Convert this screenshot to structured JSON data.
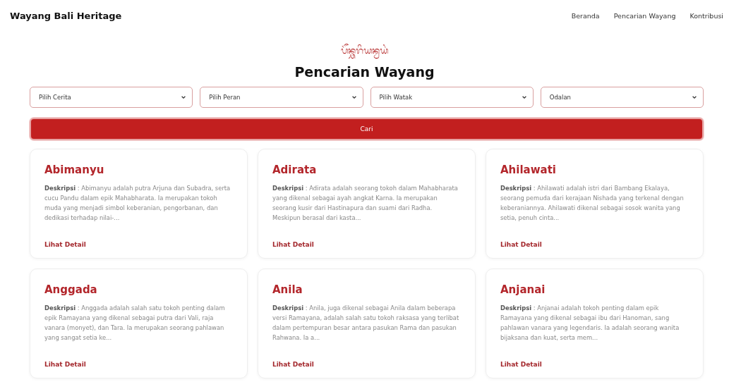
{
  "navbar": {
    "brand": "Wayang Bali Heritage",
    "links": [
      "Beranda",
      "Pencarian Wayang",
      "Kontribusi"
    ]
  },
  "page": {
    "script_title": "ᬧᭂᬦ᭄ᬘᬭᬶᬬᬦ᭄ᬯᬬᬂ",
    "title": "Pencarian Wayang"
  },
  "filters": [
    {
      "value": "Pilih Cerita"
    },
    {
      "value": "Pilih Peran"
    },
    {
      "value": "Pilih Watak"
    },
    {
      "value": "Odalan"
    }
  ],
  "search_button": "Cari",
  "cards": [
    {
      "name": "Abimanyu",
      "description": "**Deskripsi** : Abimanyu adalah putra Arjuna dan Subadra, serta cucu Pandu dalam epik Mahabharata. Ia merupakan tokoh muda yang menjadi simbol keberanian, pengorbanan, dan dedikasi terhadap nilai-...",
      "link": "Lihat Detail"
    },
    {
      "name": "Adirata",
      "description": "**Deskripsi** : Adirata adalah seorang tokoh dalam Mahabharata yang dikenal sebagai ayah angkat Karna. Ia merupakan seorang kusir dari Hastinapura dan suami dari Radha. Meskipun berasal dari kasta...",
      "link": "Lihat Detail"
    },
    {
      "name": "Ahilawati",
      "description": "**Deskripsi** : Ahilawati adalah istri dari Bambang Ekalaya, seorang pemuda dari kerajaan Nishada yang terkenal dengan keberaniannya. Ahilawati dikenal sebagai sosok wanita yang setia, penuh cinta...",
      "link": "Lihat Detail"
    },
    {
      "name": "Anggada",
      "description": "**Deskripsi** : Anggada adalah salah satu tokoh penting dalam epik Ramayana yang dikenal sebagai putra dari Vali, raja vanara (monyet), dan Tara. Ia merupakan seorang pahlawan yang sangat setia ke...",
      "link": "Lihat Detail"
    },
    {
      "name": "Anila",
      "description": "**Deskripsi** : Anila, juga dikenal sebagai Anila dalam beberapa versi Ramayana, adalah salah satu tokoh raksasa yang terlibat dalam pertempuran besar antara pasukan Rama dan pasukan Rahwana. Ia a...",
      "link": "Lihat Detail"
    },
    {
      "name": "Anjanai",
      "description": "**Deskripsi** : Anjanai adalah tokoh penting dalam epik Ramayana yang dikenal sebagai ibu dari Hanoman, sang pahlawan vanara yang legendaris. Ia adalah seorang wanita bijaksana dan kuat, serta mem...",
      "link": "Lihat Detail"
    }
  ]
}
